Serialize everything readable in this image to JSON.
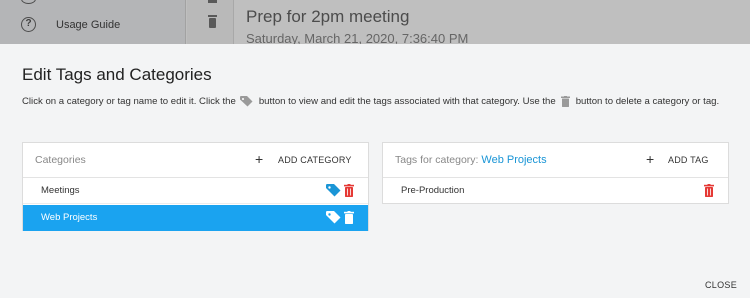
{
  "background": {
    "sidebar_item_label": "Usage Guide",
    "note_title": "Prep for 2pm meeting",
    "note_date": "Saturday, March 21, 2020, 7:36:40 PM"
  },
  "modal": {
    "title": "Edit Tags and Categories",
    "instructions": {
      "part1": "Click on a category or tag name to edit it. Click the",
      "part2": "button to view and edit the tags associated with that category. Use the",
      "part3": "button to delete a category or tag."
    },
    "categories_panel": {
      "heading": "Categories",
      "add_label": "ADD CATEGORY",
      "items": [
        {
          "label": "Meetings",
          "selected": false
        },
        {
          "label": "Web Projects",
          "selected": true
        }
      ]
    },
    "tags_panel": {
      "heading_prefix": "Tags for category:",
      "category_name": "Web Projects",
      "add_label": "ADD TAG",
      "items": [
        {
          "label": "Pre-Production"
        }
      ]
    },
    "close_label": "CLOSE"
  },
  "colors": {
    "accent": "#1aa3f0",
    "tag_icon": "#1a95d6",
    "delete_icon": "#e53935"
  },
  "icons": [
    "help-icon",
    "trash-icon",
    "tag-icon",
    "plus-icon"
  ]
}
